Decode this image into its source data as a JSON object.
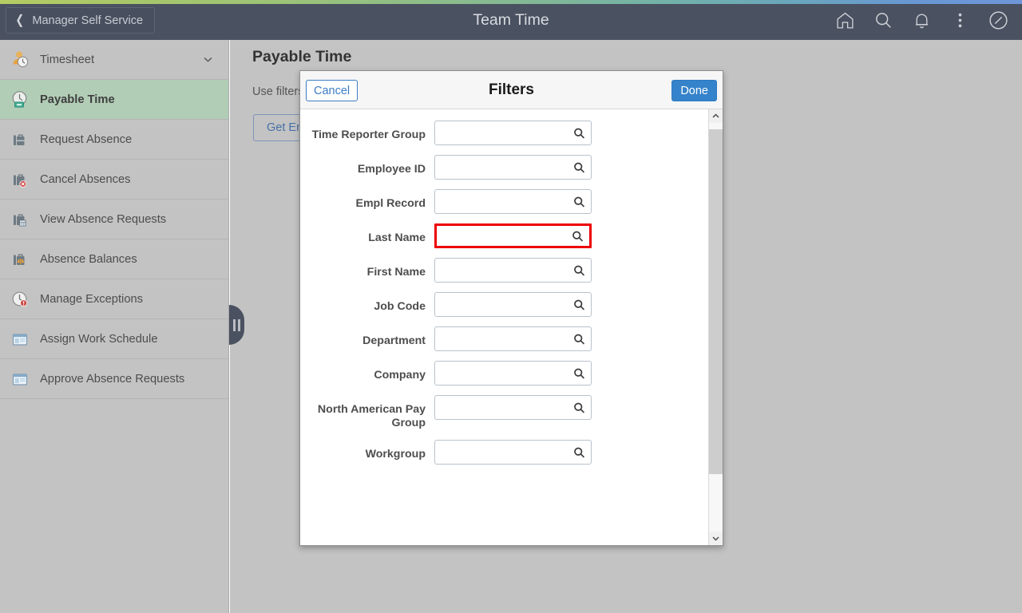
{
  "header": {
    "back_label": "Manager Self Service",
    "title": "Team Time",
    "icons": [
      {
        "name": "home-icon",
        "label": "Home"
      },
      {
        "name": "search-icon",
        "label": "Search"
      },
      {
        "name": "notifications-bell-icon",
        "label": "Notifications"
      },
      {
        "name": "actions-menu-icon",
        "label": "Actions"
      },
      {
        "name": "navbar-compass-icon",
        "label": "NavBar"
      }
    ]
  },
  "sidebar": {
    "items": [
      {
        "label": "Timesheet",
        "icon": "timesheet-person-clock-icon",
        "active": false,
        "expandable": true
      },
      {
        "label": "Payable Time",
        "icon": "payable-time-clock-icon",
        "active": true,
        "expandable": false
      },
      {
        "label": "Request Absence",
        "icon": "briefcase-icon",
        "active": false,
        "expandable": false
      },
      {
        "label": "Cancel Absences",
        "icon": "briefcase-cancel-icon",
        "active": false,
        "expandable": false
      },
      {
        "label": "View Absence Requests",
        "icon": "briefcase-calendar-icon",
        "active": false,
        "expandable": false
      },
      {
        "label": "Absence Balances",
        "icon": "briefcase-balance-icon",
        "active": false,
        "expandable": false
      },
      {
        "label": "Manage Exceptions",
        "icon": "clock-alert-icon",
        "active": false,
        "expandable": false
      },
      {
        "label": "Assign Work Schedule",
        "icon": "window-grid-icon",
        "active": false,
        "expandable": false
      },
      {
        "label": "Approve Absence Requests",
        "icon": "window-grid-icon",
        "active": false,
        "expandable": false
      }
    ],
    "collapse_handle": "collapse-sidebar-handle"
  },
  "main": {
    "page_title": "Payable Time",
    "description": "Use filters to narrow your results and then select Search Options.",
    "get_employees_label": "Get Employees"
  },
  "modal": {
    "title": "Filters",
    "cancel_label": "Cancel",
    "done_label": "Done",
    "fields": [
      {
        "label": "Time Reporter Group",
        "value": "",
        "placeholder": "",
        "highlighted": false
      },
      {
        "label": "Employee ID",
        "value": "",
        "placeholder": "",
        "highlighted": false
      },
      {
        "label": "Empl Record",
        "value": "",
        "placeholder": "",
        "highlighted": false
      },
      {
        "label": "Last Name",
        "value": "",
        "placeholder": "",
        "highlighted": true
      },
      {
        "label": "First Name",
        "value": "",
        "placeholder": "",
        "highlighted": false
      },
      {
        "label": "Job Code",
        "value": "",
        "placeholder": "",
        "highlighted": false
      },
      {
        "label": "Department",
        "value": "",
        "placeholder": "",
        "highlighted": false
      },
      {
        "label": "Company",
        "value": "",
        "placeholder": "",
        "highlighted": false
      },
      {
        "label": "North American Pay Group",
        "value": "",
        "placeholder": "",
        "highlighted": false
      },
      {
        "label": "Workgroup",
        "value": "",
        "placeholder": "",
        "highlighted": false
      }
    ],
    "scrollbar": {
      "up_arrow": "⌃",
      "down_arrow": "⌄"
    }
  },
  "colors": {
    "header_bg": "#4a5160",
    "sidebar_bg": "#c3c3c3",
    "active_nav_bg": "#b2cdb6",
    "accent_blue": "#3583ca",
    "highlight_red": "#ee0000",
    "accent_green": "#b5cc63"
  }
}
